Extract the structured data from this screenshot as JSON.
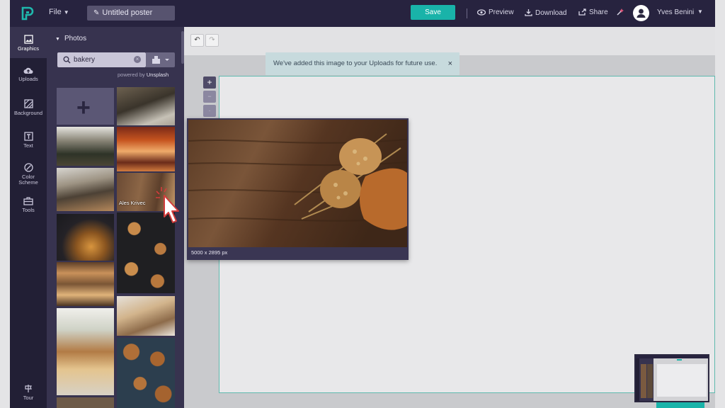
{
  "topbar": {
    "file_menu": "File",
    "doc_title": "Untitled poster",
    "save_label": "Save",
    "preview_label": "Preview",
    "download_label": "Download",
    "share_label": "Share",
    "user_name": "Yves Benini"
  },
  "rail": {
    "items": [
      {
        "label": "Graphics",
        "icon": "graphics-icon",
        "active": true
      },
      {
        "label": "Uploads",
        "icon": "cloud-upload-icon"
      },
      {
        "label": "Background",
        "icon": "background-icon"
      },
      {
        "label": "Text",
        "icon": "text-icon"
      },
      {
        "label": "Color Scheme",
        "icon": "palette-icon"
      },
      {
        "label": "Tools",
        "icon": "toolbox-icon"
      },
      {
        "label": "Tour",
        "icon": "tour-icon"
      }
    ]
  },
  "panel": {
    "heading": "Photos",
    "search_value": "bakery",
    "powered_prefix": "powered by",
    "powered_brand": "Unsplash",
    "hover_author": "Ales Krivec"
  },
  "toast": {
    "message": "We've added this image to your Uploads for future use."
  },
  "preview": {
    "dimensions": "5000 x 2895 px"
  },
  "colors": {
    "accent": "#19b3a9",
    "topbar": "#27233f",
    "panel": "#37334f"
  }
}
